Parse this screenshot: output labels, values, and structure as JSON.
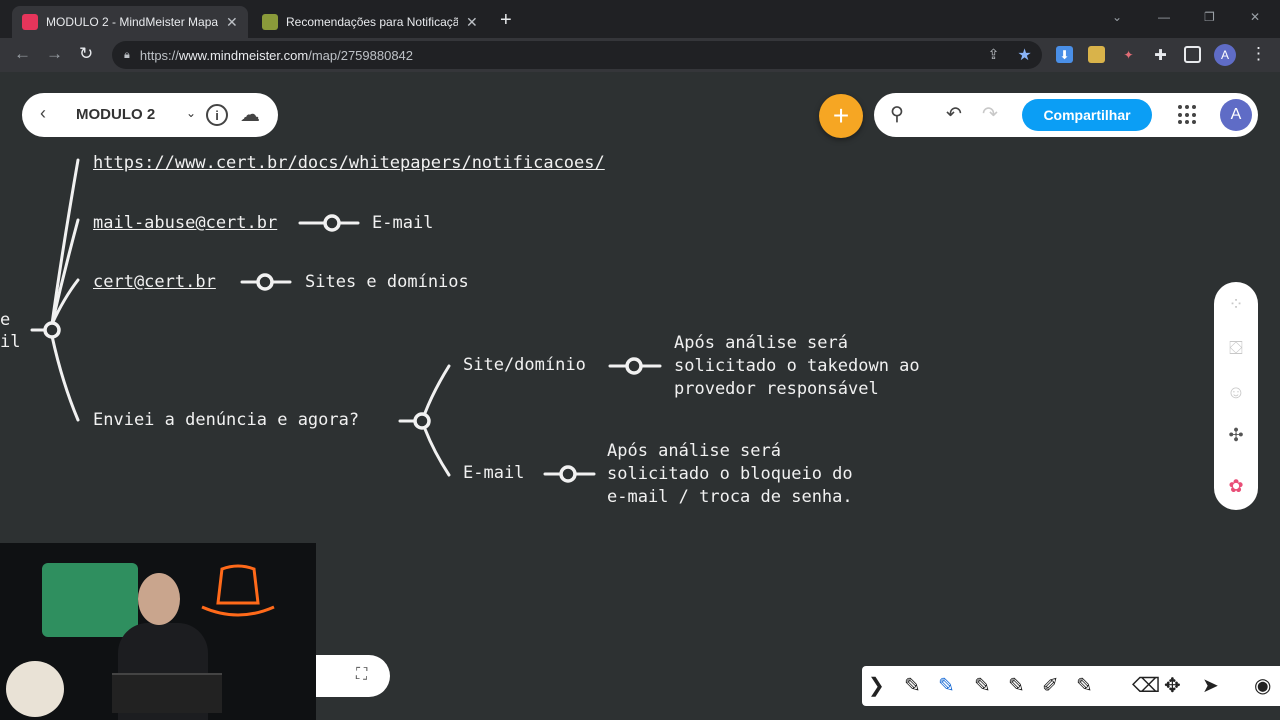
{
  "browser": {
    "tabs": [
      {
        "title": "MODULO 2 - MindMeister Mapa",
        "active": true,
        "favicon_color": "#e7355b"
      },
      {
        "title": "Recomendações para Notificaçã",
        "active": false,
        "favicon_color": "#8a9a3a"
      }
    ],
    "url_prefix": "https://",
    "url_host": "www.mindmeister.com",
    "url_path": "/map/2759880842",
    "profile_initial": "A"
  },
  "app": {
    "map_name": "MODULO 2",
    "share_label": "Compartilhar",
    "avatar_initial": "A",
    "accent_color": "#0b9ef5",
    "add_button_color": "#f6a623"
  },
  "mindmap": {
    "root_fragment_top": "e",
    "root_fragment_bottom": "il",
    "link_url": "https://www.cert.br/docs/whitepapers/notificacoes/",
    "email_abuse": "mail-abuse@cert.br",
    "email_abuse_child": "E-mail",
    "email_cert": "cert@cert.br",
    "email_cert_child": "Sites e domínios",
    "question": "Enviei a denúncia e agora?",
    "branch_site": "Site/domínio",
    "branch_site_result": "Após análise será\nsolicitado o takedown ao\nprovedor responsável",
    "branch_email": "E-mail",
    "branch_email_result": "Após análise será\nsolicitado o bloqueio do\ne-mail / troca de senha."
  },
  "icons": {
    "back": "chevron-left-icon",
    "info": "info-icon",
    "cloud": "cloud-download-icon",
    "search": "search-icon",
    "undo": "undo-icon",
    "redo": "redo-icon",
    "apps": "grid-icon"
  }
}
